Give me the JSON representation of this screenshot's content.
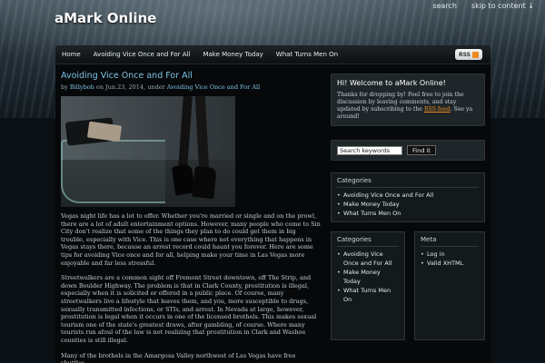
{
  "header": {
    "site_title": "aMark Online",
    "search_link": "search",
    "skip_link": "skip to content ↓"
  },
  "nav": {
    "items": [
      "Home",
      "Avoiding Vice Once and For All",
      "Make Money Today",
      "What Turns Men On"
    ],
    "rss_label": "RSS"
  },
  "post": {
    "title": "Avoiding Vice Once and For All",
    "meta_by": "by",
    "author": "Billybob",
    "meta_on": "on Jun.23, 2014, under",
    "category": "Avoiding Vice Once and For All",
    "paragraphs": [
      "Vegas night life has a lot to offer. Whether you're married or single and on the prowl, there are a lot of adult entertainment options. However, many people who come to Sin City don't realize that some of the things they plan to do could get them in big trouble, especially with Vice. This is one case where not everything that happens in Vegas stays there, because an arrest record could haunt you forever. Here are some tips for avoiding Vice once and for all, helping make your time in Las Vegas more enjoyable and far less stressful.",
      "Streetwalkers are a common sight off Fremont Street downtown, off The Strip, and down Boulder Highway. The problem is that in Clark County, prostitution is illegal, especially when it is solicited or offered in a public place. Of course, many streetwalkers live a lifestyle that leaves them, and you, more susceptible to drugs, sexually transmitted infections, or STIs, and arrest. In Nevada at large, however, prostitution is legal when it occurs in one of the licensed brothels. This makes sexual tourism one of the state's greatest draws, after gambling, of course. Where many tourists run afoul of the law is not realizing that prostitution in Clark and Washoe counties is still illegal.",
      "Many of the brothels in the Amargosa Valley northwest of Las Vegas have free shuttles"
    ]
  },
  "sidebar": {
    "welcome_title": "Hi! Welcome to aMark Online!",
    "welcome_text_1": "Thanks for dropping by! Feel free to join the discussion by leaving comments, and stay updated by subscribing to the",
    "welcome_link": "RSS feed",
    "welcome_text_2": ". See ya around!",
    "search_value": "Search keywords",
    "search_button": "Find it",
    "categories_title": "Categories",
    "categories": [
      "Avoiding Vice Once and For All",
      "Make Money Today",
      "What Turns Men On"
    ],
    "col1_title": "Categories",
    "col1_items": [
      "Avoiding Vice Once and For All",
      "Make Money Today",
      "What Turns Men On"
    ],
    "meta_title": "Meta",
    "meta_items": [
      "Log in",
      "Valid XHTML"
    ]
  },
  "colors": {
    "link_blue": "#7fc4e6",
    "accent_orange": "#f08a1c",
    "page_bg": "#0b1014"
  }
}
